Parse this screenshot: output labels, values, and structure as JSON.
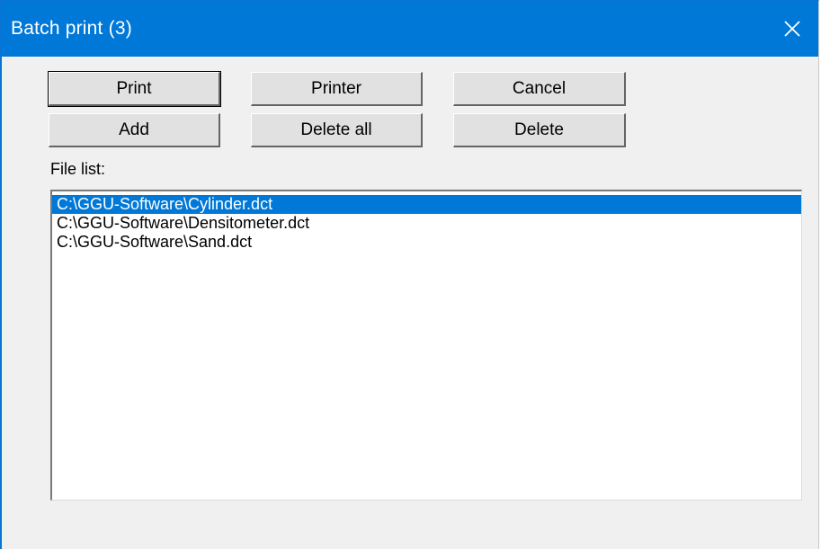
{
  "window": {
    "title": "Batch print (3)"
  },
  "buttons": {
    "print": "Print",
    "printer": "Printer",
    "cancel": "Cancel",
    "add": "Add",
    "delete_all": "Delete all",
    "delete": "Delete"
  },
  "file_list": {
    "label": "File list:",
    "items": [
      "C:\\GGU-Software\\Cylinder.dct",
      "C:\\GGU-Software\\Densitometer.dct",
      "C:\\GGU-Software\\Sand.dct"
    ],
    "selected_index": 0
  },
  "colors": {
    "titlebar": "#0078d7",
    "selection": "#0078d7",
    "dialog_bg": "#f0f0f0"
  },
  "icons": {
    "close": "close-icon"
  }
}
